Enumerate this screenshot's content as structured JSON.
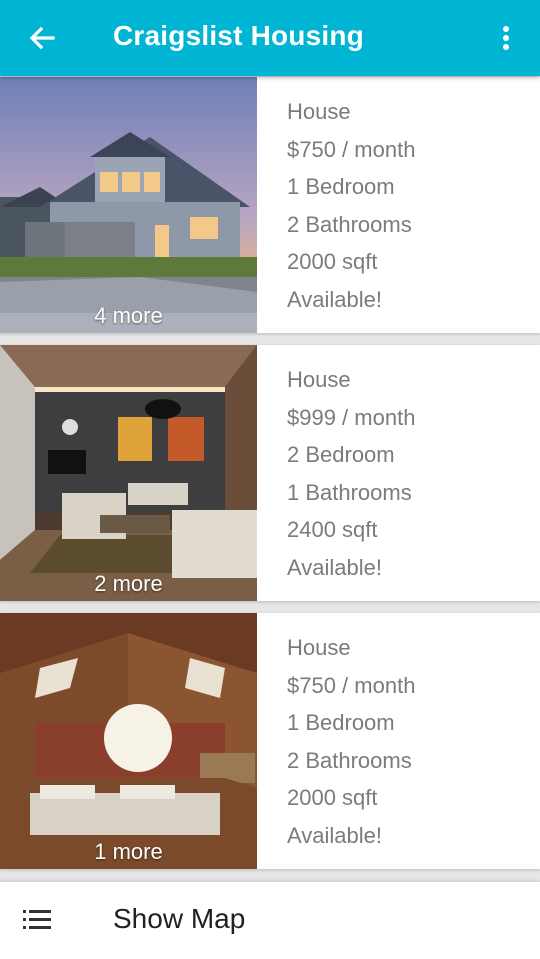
{
  "app_bar": {
    "title": "Craigslist Housing",
    "back_icon": "arrow-left-icon",
    "overflow_icon": "more-vertical-icon",
    "color": "#00b4d3"
  },
  "listings": [
    {
      "more_photos": "4 more",
      "type": "House",
      "price": "$750 / month",
      "bedrooms": "1 Bedroom",
      "bathrooms": "2 Bathrooms",
      "size": "2000 sqft",
      "status": "Available!"
    },
    {
      "more_photos": "2 more",
      "type": "House",
      "price": "$999 / month",
      "bedrooms": "2 Bedroom",
      "bathrooms": "1 Bathrooms",
      "size": "2400 sqft",
      "status": "Available!"
    },
    {
      "more_photos": "1 more",
      "type": "House",
      "price": "$750 / month",
      "bedrooms": "1 Bedroom",
      "bathrooms": "2 Bathrooms",
      "size": "2000 sqft",
      "status": "Available!"
    }
  ],
  "bottom_bar": {
    "label": "Show Map",
    "icon": "list-icon"
  }
}
